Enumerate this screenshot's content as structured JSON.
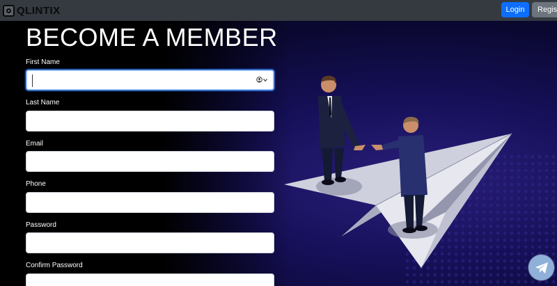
{
  "navbar": {
    "brand": "QLINTIX",
    "login_label": "Login",
    "register_label": "Register"
  },
  "form": {
    "title": "BECOME A MEMBER",
    "fields": [
      {
        "label": "First Name",
        "value": ""
      },
      {
        "label": "Last Name",
        "value": ""
      },
      {
        "label": "Email",
        "value": ""
      },
      {
        "label": "Phone",
        "value": ""
      },
      {
        "label": "Password",
        "value": ""
      },
      {
        "label": "Confirm Password",
        "value": ""
      }
    ]
  },
  "icons": {
    "logo": "qlintix-logo-icon",
    "autofill": "contact-card-icon",
    "chat": "telegram-icon"
  },
  "colors": {
    "navbar": "#343a40",
    "login_button": "#0d6efd",
    "register_button": "#6c757d",
    "hero_bg": "#16105a",
    "focus_ring": "#86b7fe"
  }
}
